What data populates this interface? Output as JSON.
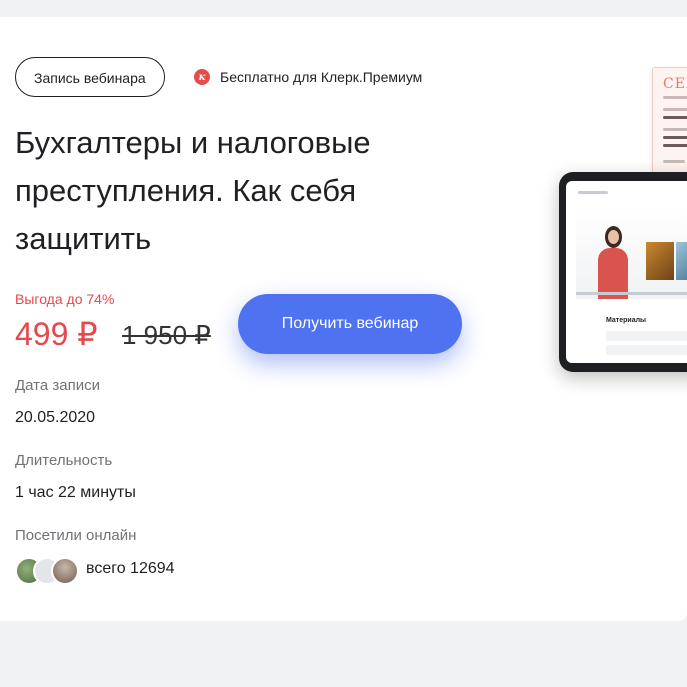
{
  "header": {
    "record_tag": "Запись вебинара",
    "premium_text": "Бесплатно для Клерк.Премиум"
  },
  "webinar": {
    "title": "Бухгалтеры и налоговые преступления. Как себя защитить"
  },
  "pricing": {
    "discount": "Выгода до 74%",
    "price": "499 ₽",
    "old_price": "1 950 ₽",
    "cta_label": "Получить вебинар"
  },
  "details": {
    "date_label": "Дата записи",
    "date_value": "20.05.2020",
    "duration_label": "Длительность",
    "duration_value": "1 час 22 минуты",
    "visitors_label": "Посетили онлайн",
    "visitors_value": "всего 12694"
  },
  "preview": {
    "cert_title": "СЕР",
    "materials_title": "Материалы"
  },
  "colors": {
    "accent": "#4f72f0",
    "price": "#e5484d",
    "background": "#f1f2f4"
  }
}
